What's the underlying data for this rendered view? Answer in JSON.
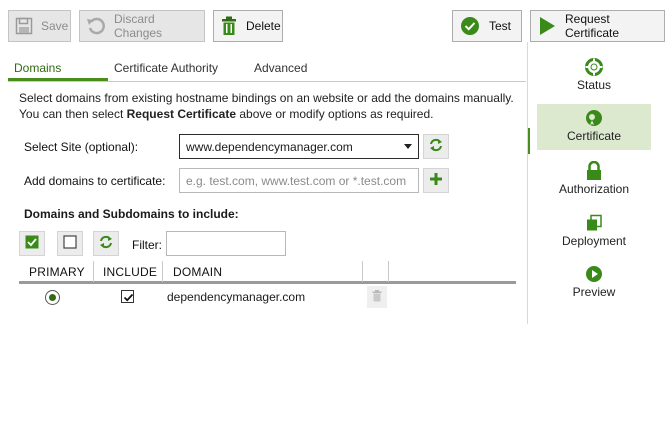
{
  "toolbar": {
    "save_label": "Save",
    "discard_label": "Discard Changes",
    "delete_label": "Delete",
    "test_label": "Test",
    "request_label": "Request Certificate"
  },
  "tabs": [
    {
      "label": "Domains",
      "active": true
    },
    {
      "label": "Certificate Authority",
      "active": false
    },
    {
      "label": "Advanced",
      "active": false
    }
  ],
  "description": {
    "line1": "Select domains from existing hostname bindings on an website or add the domains manually.",
    "line2_pre": "You can then select ",
    "line2_bold": "Request Certificate",
    "line2_post": " above or modify options as required."
  },
  "site": {
    "label": "Select Site (optional):",
    "value": "www.dependencymanager.com"
  },
  "add_domains": {
    "label": "Add domains to certificate:",
    "placeholder": "e.g. test.com, www.test.com or *.test.com",
    "value": ""
  },
  "domains_section": {
    "title": "Domains and Subdomains to include:",
    "filter_label": "Filter:",
    "filter_value": ""
  },
  "grid": {
    "headers": [
      "PRIMARY",
      "INCLUDE",
      "DOMAIN"
    ],
    "rows": [
      {
        "primary": true,
        "include": true,
        "domain": "dependencymanager.com"
      }
    ]
  },
  "nav": [
    {
      "label": "Status",
      "icon": "lifebuoy-icon"
    },
    {
      "label": "Certificate",
      "icon": "certificate-icon",
      "active": true
    },
    {
      "label": "Authorization",
      "icon": "lock-icon"
    },
    {
      "label": "Deployment",
      "icon": "copy-icon"
    },
    {
      "label": "Preview",
      "icon": "play-icon"
    }
  ],
  "colors": {
    "accent": "#4a8d1d",
    "active_nav_bg": "#dde9cf"
  }
}
